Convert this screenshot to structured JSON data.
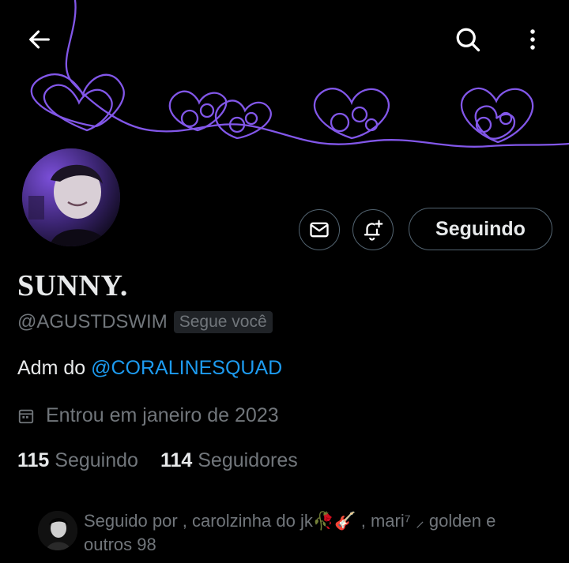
{
  "header": {
    "back_icon": "arrow-left-icon",
    "search_icon": "search-icon",
    "more_icon": "more-vertical-icon"
  },
  "banner": {
    "description_color": "#8a5cf6"
  },
  "actions": {
    "message_icon": "envelope-icon",
    "notify_icon": "bell-plus-icon",
    "follow_label": "Seguindo"
  },
  "profile": {
    "display_name": "SUNNY.",
    "handle": "@AGUSTDSWIM",
    "follows_you": "Segue você",
    "bio_prefix": "Adm do ",
    "bio_mention": "@CORALINESQUAD",
    "joined": "Entrou em janeiro de 2023"
  },
  "stats": {
    "following_count": "115",
    "following_label": "Seguindo",
    "followers_count": "114",
    "followers_label": "Seguidores"
  },
  "followed_by": {
    "text": "Seguido por , carolzinha do jk🥀🎸 , mari⁷ ⸝ golden e",
    "text2": "outros 98"
  },
  "colors": {
    "link": "#1d9bf0",
    "muted": "#71767b",
    "accent": "#8a5cf6"
  }
}
